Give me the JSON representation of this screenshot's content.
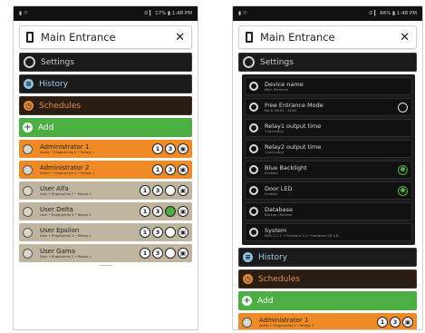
{
  "left": {
    "status": {
      "left": "▮ ☉",
      "right": "⏲ ▎ 17% ▮ 1:48 PM"
    },
    "title": "Main Entrance",
    "close_glyph": "✕",
    "sections": {
      "settings": "Settings",
      "history": "History",
      "schedules": "Schedules",
      "add": "Add"
    },
    "users": [
      {
        "name": "Administrator 1",
        "sub": "Admin • Fingerprints 2 • Relays 1",
        "type": "admin",
        "b1": "1",
        "b2": "3",
        "b4": "on"
      },
      {
        "name": "Administrator 2",
        "sub": "Admin • Fingerprints 2 • Relays 1",
        "type": "admin",
        "b1": "1",
        "b2": "3",
        "b4": ""
      },
      {
        "name": "User Alfa",
        "sub": "User • Fingerprints 2 • Relays 1",
        "type": "guest",
        "b1": "1",
        "b2": "3",
        "b4": ""
      },
      {
        "name": "User Delta",
        "sub": "User • Fingerprints 2 • Relays 1",
        "type": "guest",
        "b1": "1",
        "b2": "3",
        "b4": ""
      },
      {
        "name": "User Epsilon",
        "sub": "User • Fingerprints 2 • Relays 1",
        "type": "guest",
        "b1": "1",
        "b2": "3",
        "b4": ""
      },
      {
        "name": "User Gama",
        "sub": "User • Fingerprints 2 • Relays 1",
        "type": "guest",
        "b1": "1",
        "b2": "3",
        "b4": ""
      }
    ]
  },
  "right": {
    "status": {
      "left": "▮ ☉",
      "right": "⏲ ▎ 86% ▮ 1:48 PM"
    },
    "title": "Main Entrance",
    "close_glyph": "✕",
    "sections": {
      "settings": "Settings",
      "history": "History",
      "schedules": "Schedules",
      "add": "Add"
    },
    "settings_rows": [
      {
        "name": "Device name",
        "sub": "Main Entrance",
        "toggle": ""
      },
      {
        "name": "Free Entrance Mode",
        "sub": "Mo-Fr 08:00 - 16:00",
        "toggle": "off"
      },
      {
        "name": "Relay1 output time",
        "sub": "1 second(s)",
        "toggle": ""
      },
      {
        "name": "Relay2 output time",
        "sub": "1 second(s)",
        "toggle": ""
      },
      {
        "name": "Blue Backlight",
        "sub": "Enabled",
        "toggle": "on"
      },
      {
        "name": "Door LED",
        "sub": "Enabled",
        "toggle": "on"
      },
      {
        "name": "Database",
        "sub": "Backup / Restore",
        "toggle": ""
      },
      {
        "name": "System",
        "sub": "BIOS 2.7.1 • Firmware 3.2 • Hardware 2B 0.8",
        "toggle": ""
      }
    ],
    "users": [
      {
        "name": "Administrator 1",
        "sub": "Admin • Fingerprints 2 • Relays 1",
        "type": "admin",
        "b1": "1",
        "b2": "3"
      }
    ]
  }
}
